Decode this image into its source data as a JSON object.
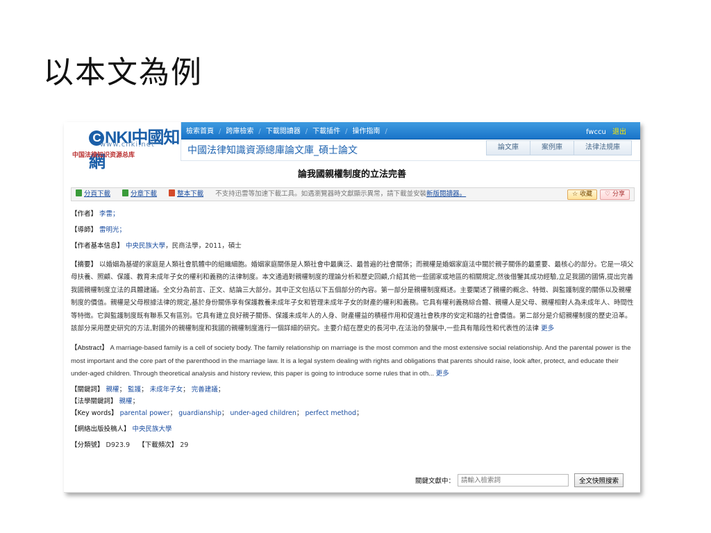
{
  "slide": {
    "title": "以本文為例"
  },
  "logo": {
    "main": "NKI中國知網",
    "url": "www.cnki.net",
    "sub": "中国法律知识资源总库"
  },
  "nav": [
    "檢索首頁",
    "跨庫檢索",
    "下載閱讀器",
    "下載插件",
    "操作指南"
  ],
  "user": {
    "name": "fwccu",
    "logout": "退出"
  },
  "header": {
    "subtitle": "中國法律知識資源總庫論文庫_碩士論文"
  },
  "lib_tabs": [
    "論文庫",
    "案例庫",
    "法律法規庫"
  ],
  "paper": {
    "title": "論我國親權制度的立法完善"
  },
  "downloads": {
    "page": "分頁下載",
    "chapter": "分章下載",
    "whole": "整本下載",
    "note": "不支持迅雷等加速下載工具。如遇瀏覽器時文獻顯示異常，請下載並安裝",
    "note_link": "新版閱讀器。",
    "favorite": "收藏",
    "share": "分享"
  },
  "meta": {
    "author_label": "【作者】",
    "author": "李雷；",
    "advisor_label": "【導師】",
    "advisor": "雷明光；",
    "info_label": "【作者基本信息】",
    "info_school": "中央民族大學",
    "info_rest": "，民商法學，2011，碩士"
  },
  "abstract": {
    "label": "【摘要】",
    "text": "以婚姻為基礎的家庭是人類社會肌體中的組織細胞。婚姻家庭關係是人類社會中最廣泛、最普遍的社會關係；而親權是婚姻家庭法中關於親子關係的最重要、最核心的部分。它是一項父母扶養、照顧、保護、教育未成年子女的權利和義務的法律制度。本文通過對親權制度的理論分析和歷史回顧,介紹其他一些國家或地區的相關規定,然後借鑒其成功經驗,立足我國的國情,提出完善我國親權制度立法的具體建議。全文分為前言、正文、結論三大部分。其中正文包括以下五個部分的內容。第一部分是親權制度概述。主要闡述了親權的概念、特徵、與監護制度的關係以及親權制度的價值。親權是父母根據法律的規定,基於身份關係享有保護教養未成年子女和管理未成年子女的財產的權利和義務。它具有權利義務綜合體、親權人是父母、親權相對人為未成年人、時間性等特徵。它與監護制度既有聯系又有區別。它具有建立良好親子關係、保護未成年人的人身、財產權益的積極作用和促進社會秩序的安定和諧的社會價值。第二部分是介紹親權制度的歷史沿革。該部分采用歷史研究的方法,對國外的親權制度和我國的親權制度進行一個詳細的研究。主要介紹在歷史的長河中,在法治的發展中,一些具有階段性和代表性的法律",
    "more": "更多"
  },
  "abstract_en": {
    "label": "【Abstract】",
    "text": "A marriage-based family is a cell of society body. The family relationship on marriage is the most common and the most extensive social relationship. And the parental power is the most important and the core part of the parenthood in the marriage law. It is a legal system dealing with rights and obligations that parents should raise, look after, protect, and educate their under-aged children. Through theoretical analysis and history review, this paper is going to introduce some rules that in oth...",
    "more": "更多"
  },
  "keywords": {
    "cn_label": "【關鍵詞】",
    "cn": [
      "親權",
      "監護",
      "未成年子女",
      "完善建議"
    ],
    "law_label": "【法學關鍵詞】",
    "law": [
      "親權"
    ],
    "en_label": "【Key words】",
    "en": [
      "parental power",
      "guardianship",
      "under-aged children",
      "perfect method"
    ]
  },
  "publisher": {
    "label": "【網絡出版投稿人】",
    "value": "中央民族大學"
  },
  "classification": {
    "label": "【分類號】",
    "value": "D923.9",
    "downloads_label": "【下載頻次】",
    "downloads": "29"
  },
  "search": {
    "label": "關鍵文獻中：",
    "placeholder": "請輸入檢索詞",
    "button": "全文快照搜索"
  }
}
